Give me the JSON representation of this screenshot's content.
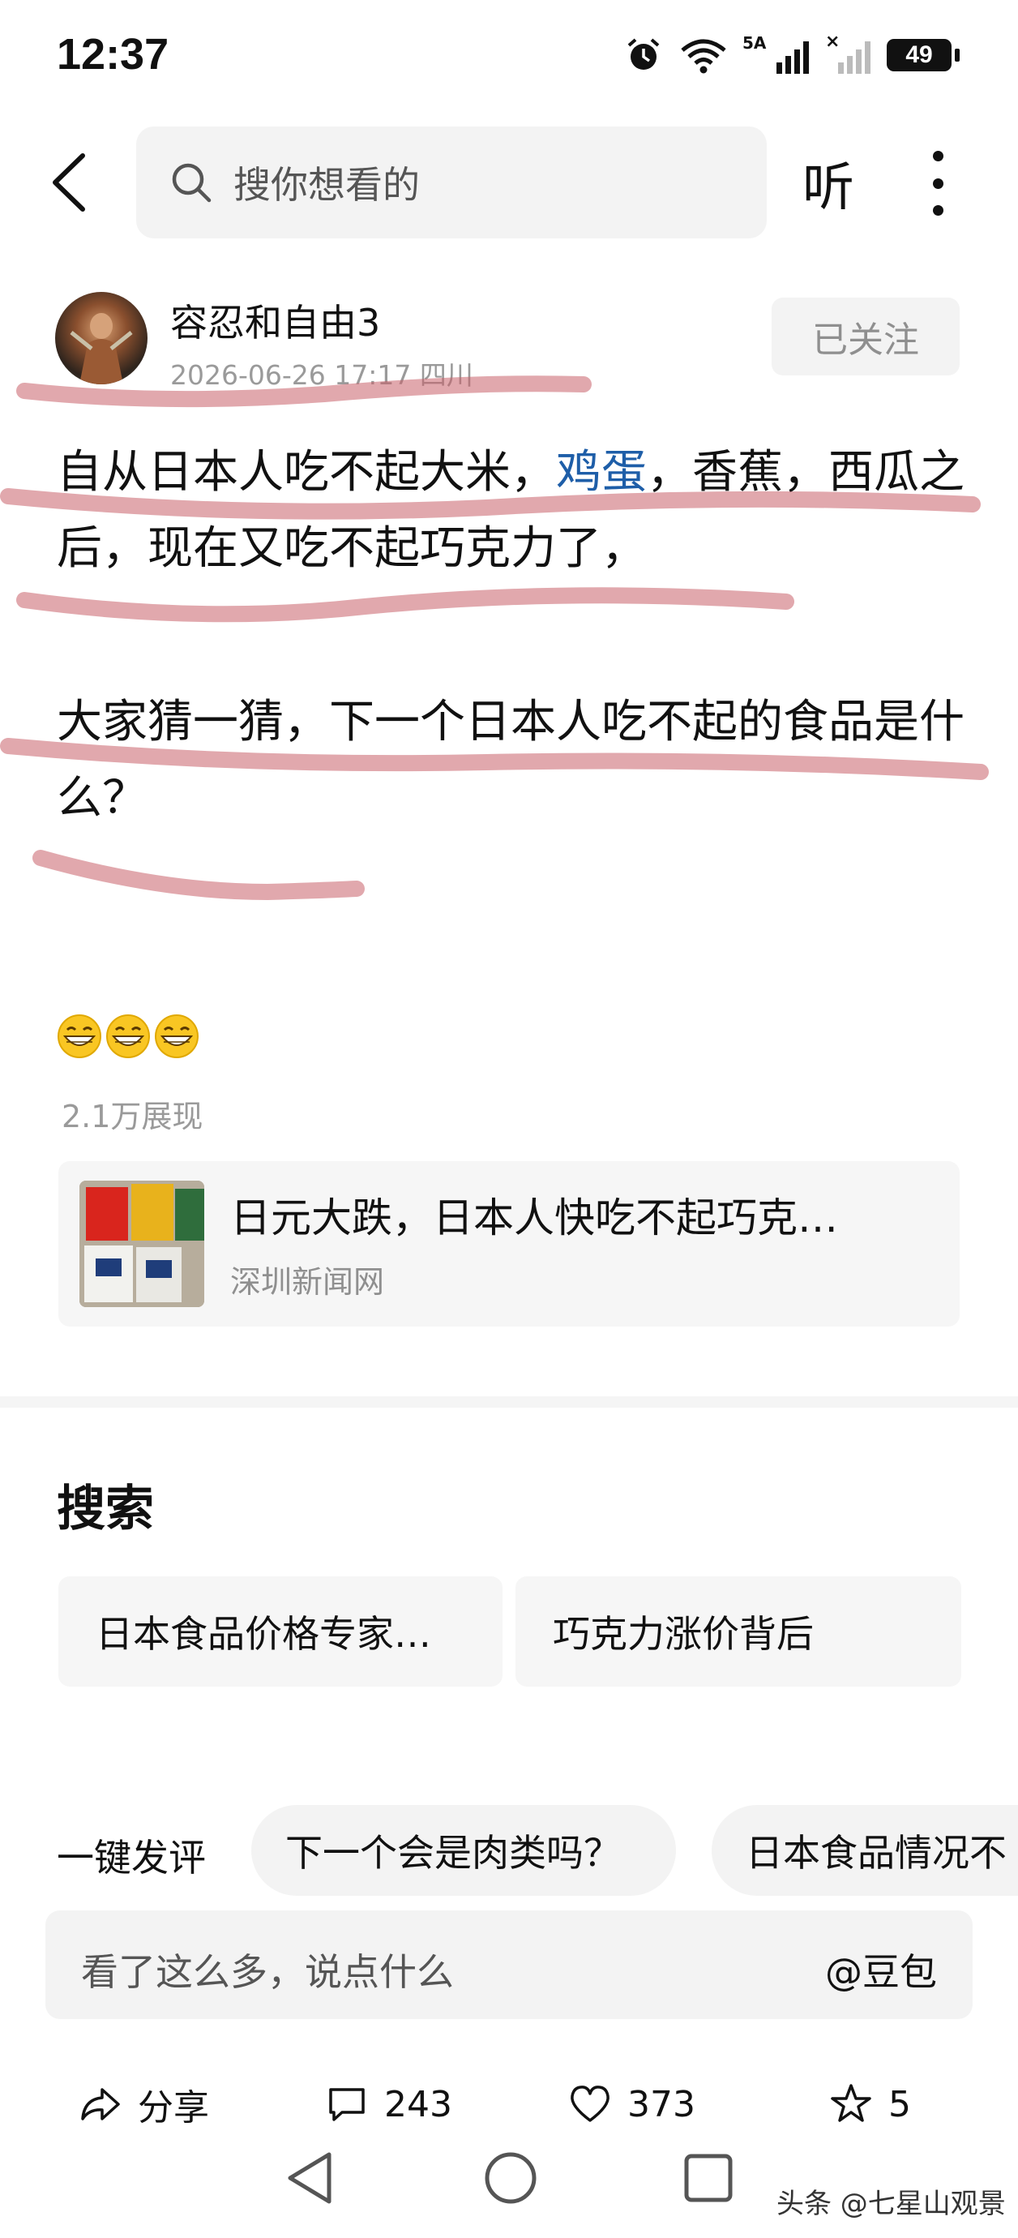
{
  "status_bar": {
    "time": "12:37",
    "network": "5A",
    "battery": "49"
  },
  "top_bar": {
    "search_placeholder": "搜你想看的",
    "listen_label": "听"
  },
  "author": {
    "name": "容忍和自由3",
    "meta": "2026-06-26 17:17 四川",
    "follow_label": "已关注"
  },
  "post": {
    "p1_before": "自从日本人吃不起大米，",
    "p1_link": "鸡蛋",
    "p1_after": "，香蕉，西瓜之后，现在又吃不起巧克力了，",
    "p2": "大家猜一猜，下一个日本人吃不起的食品是什么？",
    "emoji": [
      "grinning-face",
      "grinning-face",
      "grinning-face"
    ],
    "views": "2.1万展现"
  },
  "news_card": {
    "title": "日元大跌，日本人快吃不起巧克…",
    "source": "深圳新闻网"
  },
  "search_section": {
    "title": "搜索",
    "chips": [
      "日本食品价格专家…",
      "巧克力涨价背后"
    ]
  },
  "quick_comment": {
    "label": "一键发评",
    "chips": [
      "下一个会是肉类吗？",
      "日本食品情况不"
    ]
  },
  "comment_input": {
    "placeholder": "看了这么多，说点什么",
    "mention": "@豆包"
  },
  "actions": {
    "share": "分享",
    "comments": "243",
    "likes": "373",
    "favorites": "5"
  },
  "watermark": "头条 @七星山观景",
  "colors": {
    "link": "#1e5ea8",
    "annotation": "#c8606a"
  }
}
